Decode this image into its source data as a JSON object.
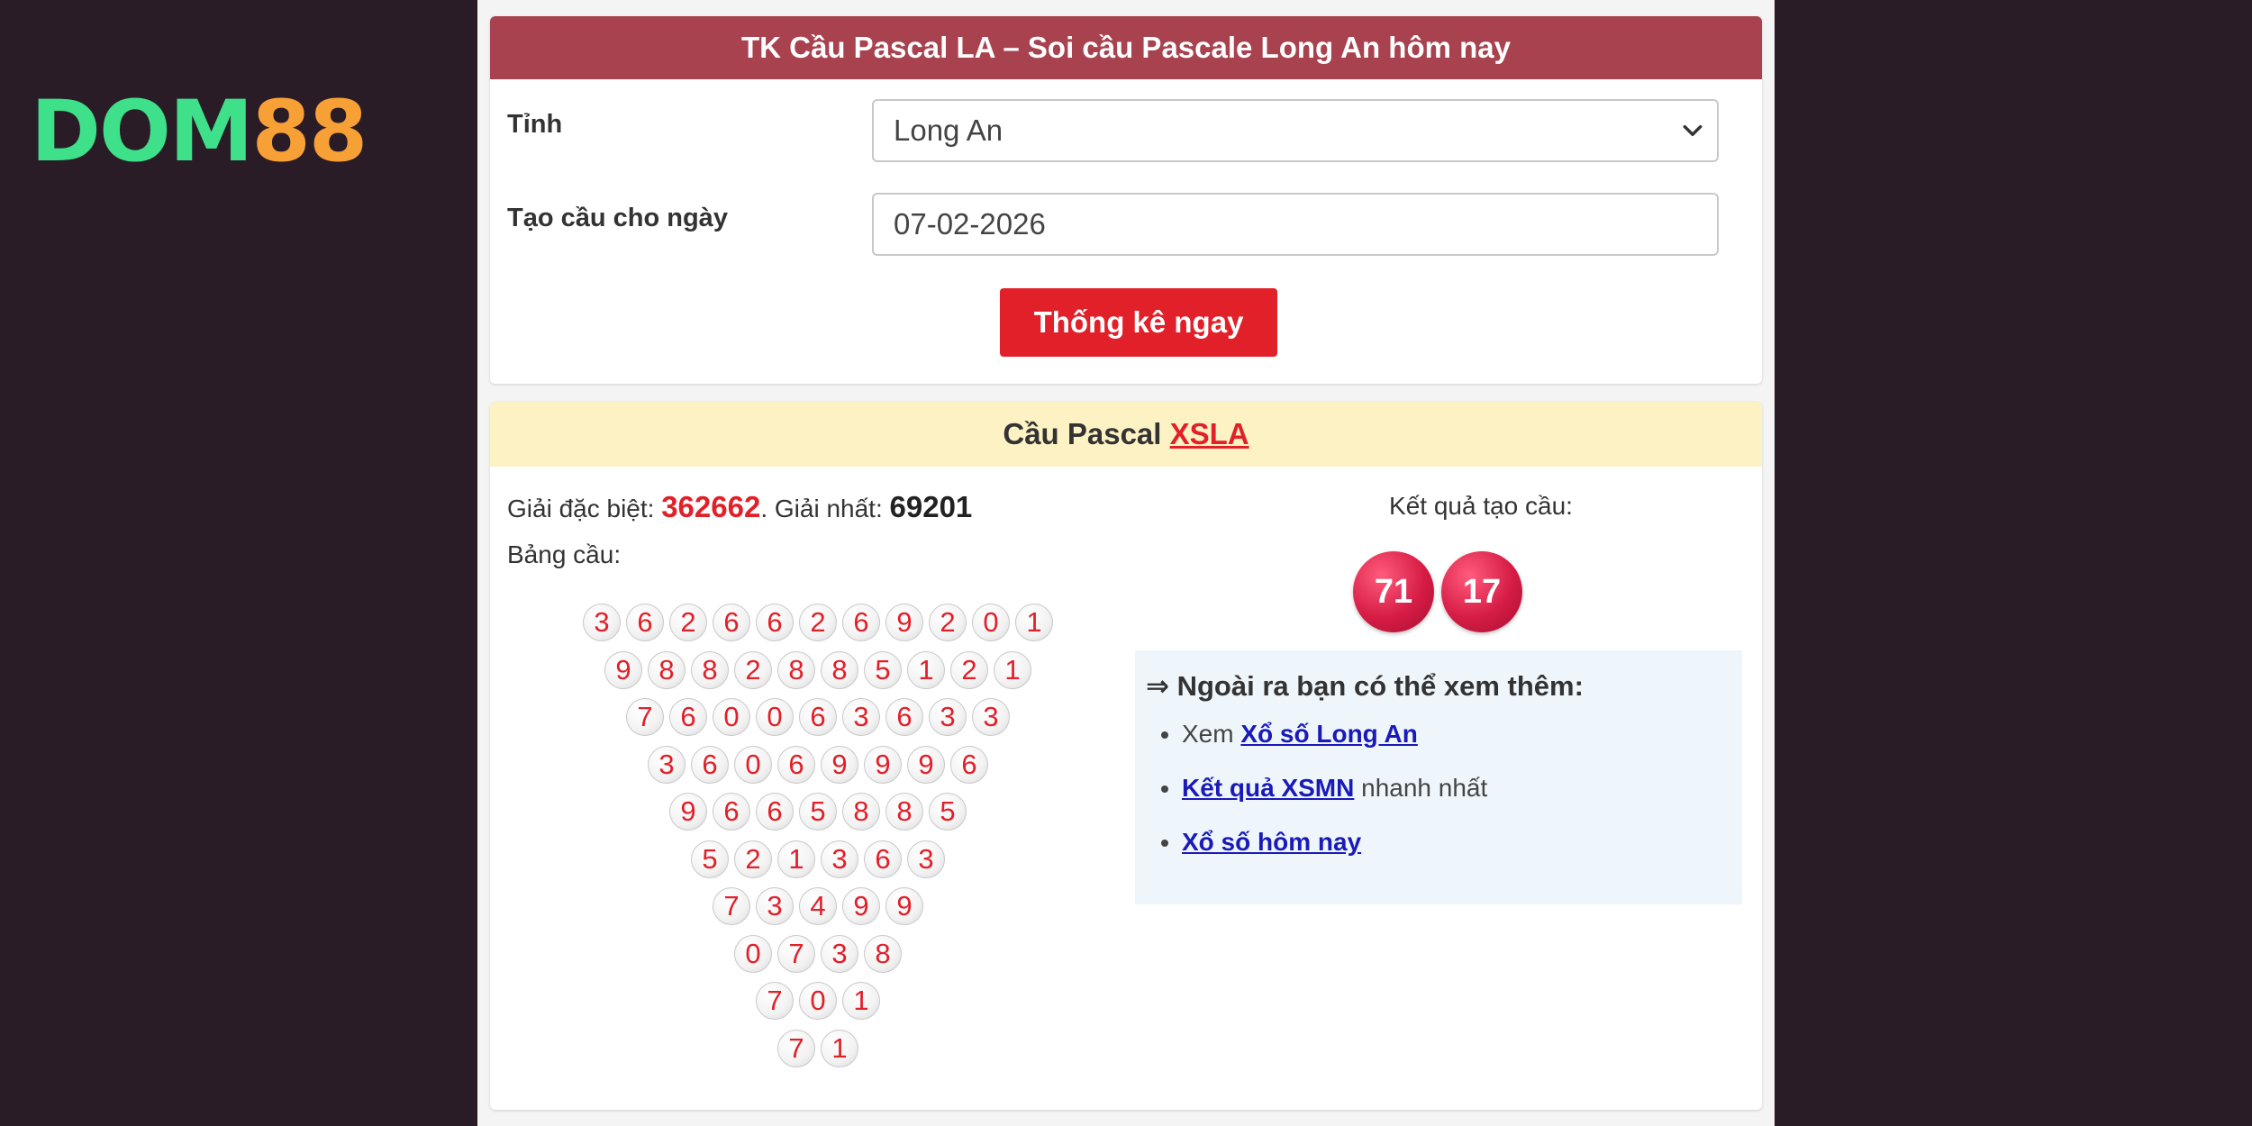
{
  "logo": {
    "part1": "DOM",
    "part2": "88"
  },
  "form": {
    "title": "TK Cầu Pascal LA – Soi cầu Pascale Long An hôm nay",
    "province_label": "Tỉnh",
    "province_value": "Long An",
    "date_label": "Tạo cầu cho ngày",
    "date_value": "07-02-2026",
    "submit_label": "Thống kê ngay"
  },
  "result": {
    "title_prefix": "Cầu Pascal ",
    "title_link": "XSLA",
    "special_label": "Giải đặc biệt: ",
    "special_value": "362662",
    "first_label": ". Giải nhất: ",
    "first_value": "69201",
    "table_label": "Bảng cầu:",
    "result_label": "Kết quả tạo cầu:",
    "result_values": [
      "71",
      "17"
    ],
    "triangle": [
      [
        "3",
        "6",
        "2",
        "6",
        "6",
        "2",
        "6",
        "9",
        "2",
        "0",
        "1"
      ],
      [
        "9",
        "8",
        "8",
        "2",
        "8",
        "8",
        "5",
        "1",
        "2",
        "1"
      ],
      [
        "7",
        "6",
        "0",
        "0",
        "6",
        "3",
        "6",
        "3",
        "3"
      ],
      [
        "3",
        "6",
        "0",
        "6",
        "9",
        "9",
        "9",
        "6"
      ],
      [
        "9",
        "6",
        "6",
        "5",
        "8",
        "8",
        "5"
      ],
      [
        "5",
        "2",
        "1",
        "3",
        "6",
        "3"
      ],
      [
        "7",
        "3",
        "4",
        "9",
        "9"
      ],
      [
        "0",
        "7",
        "3",
        "8"
      ],
      [
        "7",
        "0",
        "1"
      ],
      [
        "7",
        "1"
      ]
    ]
  },
  "more": {
    "title": "⇒ Ngoài ra bạn có thể xem thêm:",
    "item1_prefix": "Xem ",
    "item1_link": "Xổ số Long An",
    "item2_link": "Kết quả XSMN",
    "item2_suffix": " nhanh nhất",
    "item3_link": "Xổ số hôm nay"
  },
  "colors": {
    "background": "#2a1c27",
    "header_red": "#a8424f",
    "accent_red": "#e12029",
    "result_header_bg": "#fdf2c4",
    "link_blue": "#1a1ab8",
    "logo_green": "#3ee08a",
    "logo_orange": "#f7a035"
  }
}
